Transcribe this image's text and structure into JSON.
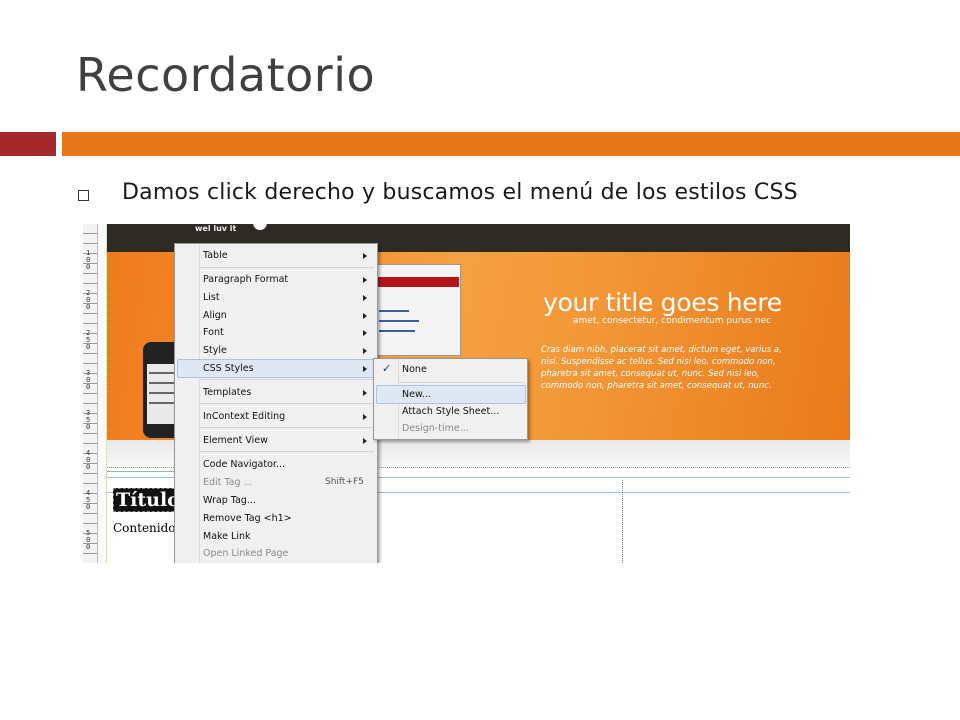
{
  "slide": {
    "title": "Recordatorio",
    "bullet": "Damos click derecho y buscamos el menú de los estilos CSS",
    "colors": {
      "accent_red": "#a5282c",
      "accent_orange": "#e8761b",
      "title": "#404040"
    }
  },
  "screenshot": {
    "ruler_labels": [
      "1\n0\n0",
      "2\n0\n0",
      "2\n5\n0",
      "3\n0\n0",
      "3\n5\n0",
      "4\n0\n0",
      "4\n5\n0",
      "5\n0\n0"
    ],
    "brand": "wel luv it",
    "banner": {
      "title": "your title goes here",
      "subtitle": "amet, consectetur,      condimentum purus nec",
      "text": "Cras diam nibh, placerat sit amet, dictum eget, varius a, nisi. Suspendisse ac tellus. Sed nisi leo, commodo non, pharetra sit amet, consequat ut, nunc. Sed nisi leo, commodo non, pharetra sit amet, consequat ut, nunc."
    },
    "heading": "Título",
    "content": "Contenido"
  },
  "context_menu": {
    "items": [
      {
        "label": "Table",
        "submenu": true,
        "disabled": false
      },
      {
        "label": "Paragraph Format",
        "submenu": true,
        "disabled": false
      },
      {
        "label": "List",
        "submenu": true,
        "disabled": false
      },
      {
        "label": "Align",
        "submenu": true,
        "disabled": false
      },
      {
        "label": "Font",
        "submenu": true,
        "disabled": false
      },
      {
        "label": "Style",
        "submenu": true,
        "disabled": false
      },
      {
        "label": "CSS Styles",
        "submenu": true,
        "disabled": false,
        "highlighted": true
      },
      {
        "label": "Templates",
        "submenu": true,
        "disabled": false
      },
      {
        "label": "InContext Editing",
        "submenu": true,
        "disabled": false
      },
      {
        "label": "Element View",
        "submenu": true,
        "disabled": false
      },
      {
        "label": "Code Navigator...",
        "submenu": false,
        "disabled": false
      },
      {
        "label": "Edit Tag ...",
        "submenu": false,
        "disabled": true,
        "shortcut": "Shift+F5"
      },
      {
        "label": "Wrap Tag...",
        "submenu": false,
        "disabled": false
      },
      {
        "label": "Remove Tag <h1>",
        "submenu": false,
        "disabled": false
      },
      {
        "label": "Make Link",
        "submenu": false,
        "disabled": false
      },
      {
        "label": "Open Linked Page",
        "submenu": false,
        "disabled": true
      }
    ]
  },
  "css_submenu": {
    "items": [
      {
        "label": "None",
        "checked": true,
        "disabled": false
      },
      {
        "label": "New...",
        "highlighted": true,
        "disabled": false
      },
      {
        "label": "Attach Style Sheet...",
        "disabled": false
      },
      {
        "label": "Design-time...",
        "disabled": true
      }
    ]
  }
}
